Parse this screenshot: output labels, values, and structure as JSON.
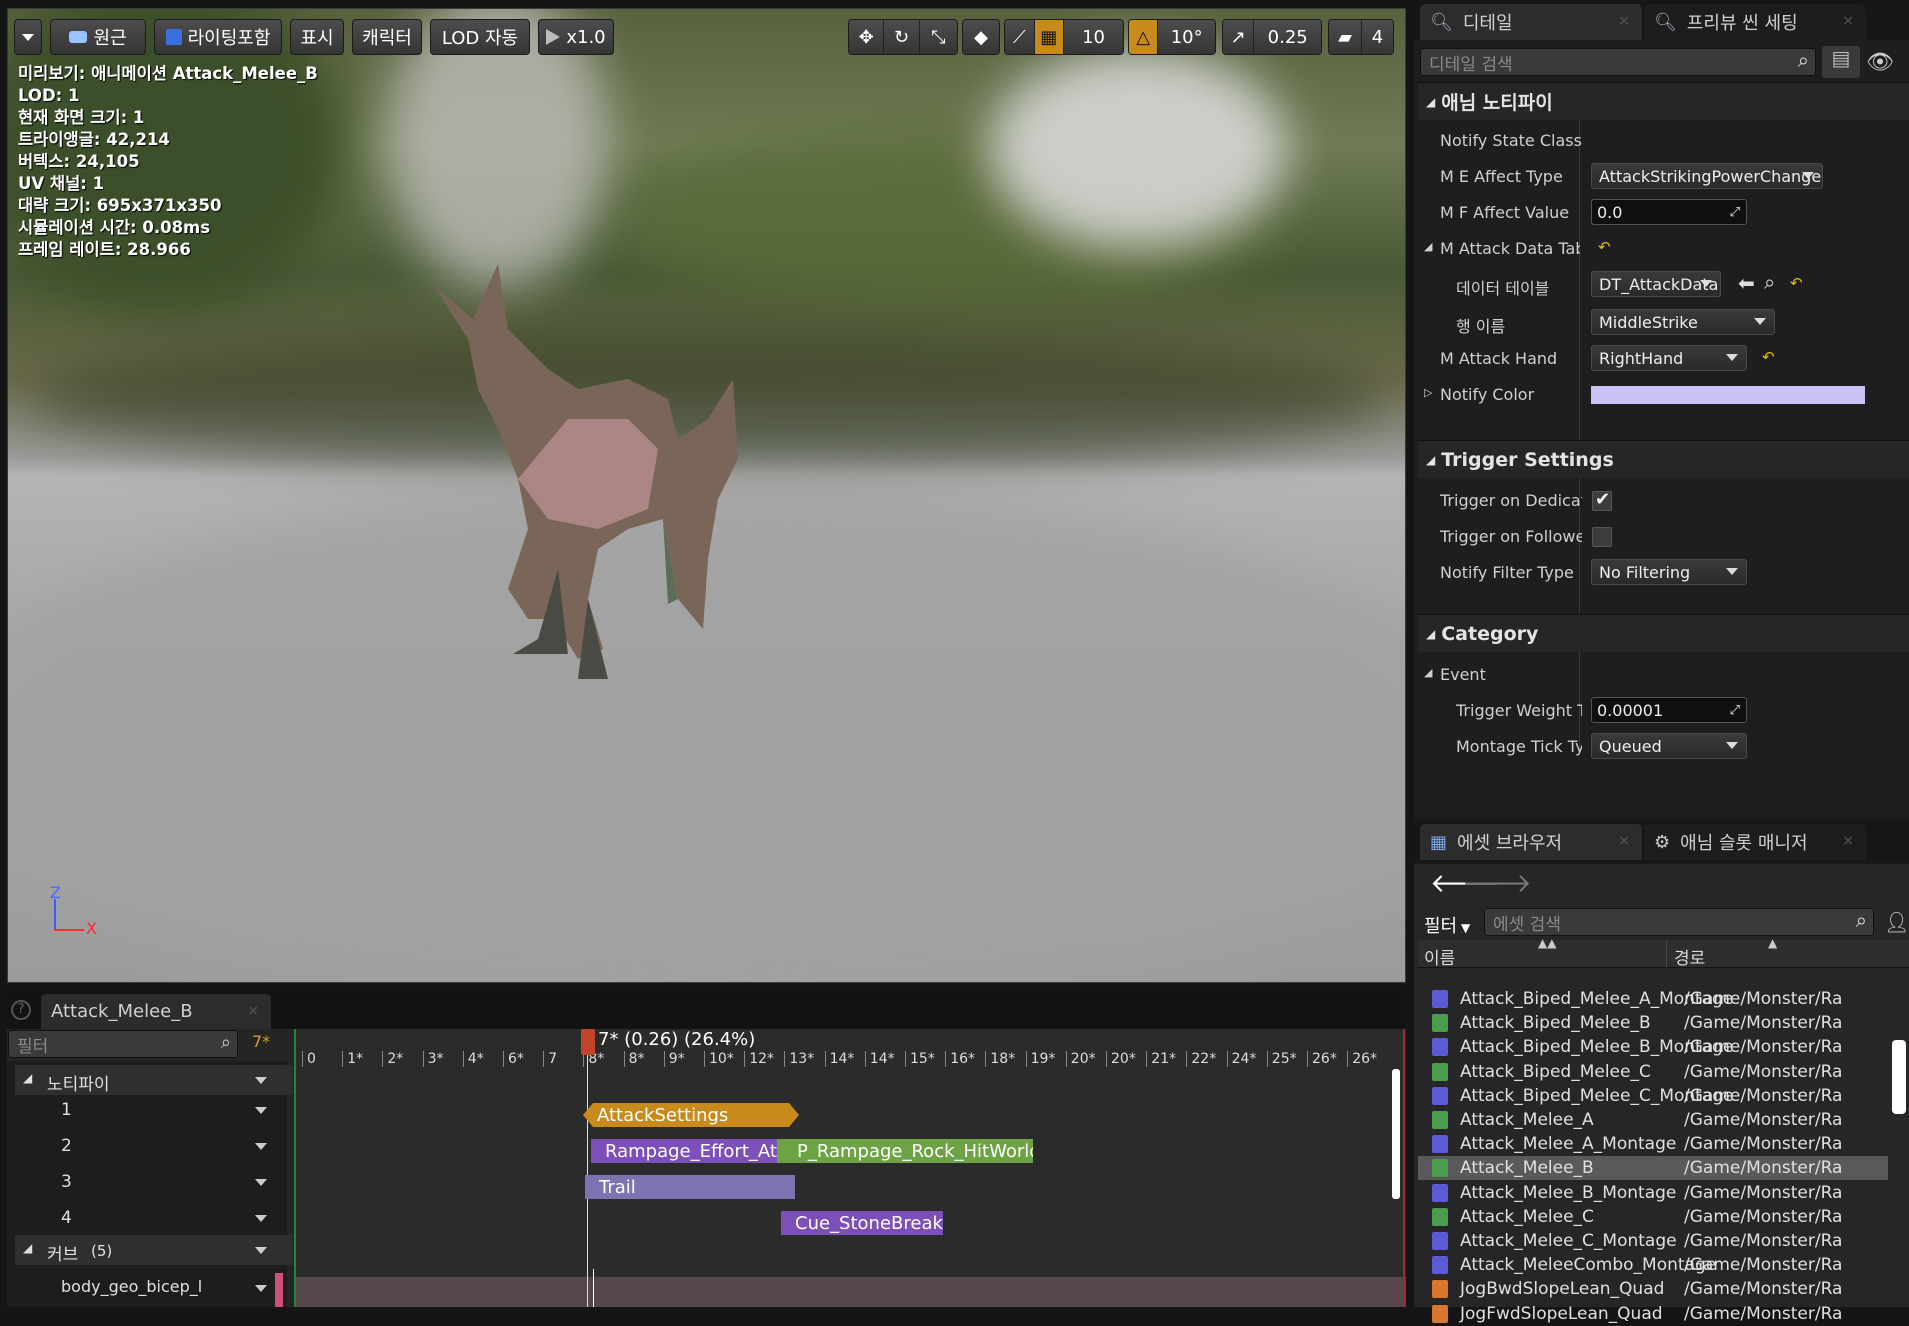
{
  "toolbar": {
    "perspective": "원근",
    "lighting": "라이팅포함",
    "show": "표시",
    "character": "캐릭터",
    "lod": "LOD 자동",
    "speed": "x1.0",
    "grid_snap": "10",
    "rot_snap": "10°",
    "scale_snap": "0.25",
    "cam_speed": "4"
  },
  "stats": [
    "미리보기: 애니메이션 Attack_Melee_B",
    "LOD: 1",
    "현재 화면 크기: 1",
    "트라이앵글: 42,214",
    "버텍스: 24,105",
    "UV 채널: 1",
    "대략 크기: 695x371x350",
    "시뮬레이션 시간: 0.08ms",
    "프레임 레이트: 28.966"
  ],
  "axes": {
    "z": "Z",
    "x": "X"
  },
  "details": {
    "tab1": "디테일",
    "tab2": "프리뷰 씬 세팅",
    "search_placeholder": "디테일 검색",
    "cat_notify": "애님 노티파이",
    "notify_state_class": "Notify State Class",
    "me_affect_type": "M E Affect Type",
    "me_affect_type_value": "AttackStrikingPowerChange",
    "mf_affect_value": "M F Affect Value",
    "mf_affect_value_value": "0.0",
    "m_attack_data_table": "M Attack Data Table",
    "data_table": "데이터 테이블",
    "data_table_value": "DT_AttackData",
    "row_name": "행 이름",
    "row_name_value": "MiddleStrike",
    "m_attack_hand": "M Attack Hand",
    "m_attack_hand_value": "RightHand",
    "notify_color": "Notify Color",
    "notify_color_value": "#c9c3f5",
    "cat_trigger": "Trigger Settings",
    "trigger_dedicated": "Trigger on Dedicated Server",
    "trigger_dedicated_checked": true,
    "trigger_follower": "Trigger on Follower",
    "trigger_follower_checked": false,
    "notify_filter_type": "Notify Filter Type",
    "notify_filter_type_value": "No Filtering",
    "cat_category": "Category",
    "event": "Event",
    "trigger_weight": "Trigger Weight Threshold",
    "trigger_weight_value": "0.00001",
    "montage_tick": "Montage Tick Type",
    "montage_tick_value": "Queued"
  },
  "assets": {
    "tab1": "에셋 브라우저",
    "tab2": "애님 슬롯 매니저",
    "filter": "필터",
    "search_placeholder": "에셋 검색",
    "col_name": "이름",
    "col_path": "경로",
    "rows": [
      {
        "name": "Attack_Biped_Melee_A_Montage",
        "path": "/Game/Monster/Ra",
        "kind": "montage"
      },
      {
        "name": "Attack_Biped_Melee_B",
        "path": "/Game/Monster/Ra",
        "kind": "anim"
      },
      {
        "name": "Attack_Biped_Melee_B_Montage",
        "path": "/Game/Monster/Ra",
        "kind": "montage"
      },
      {
        "name": "Attack_Biped_Melee_C",
        "path": "/Game/Monster/Ra",
        "kind": "anim"
      },
      {
        "name": "Attack_Biped_Melee_C_Montage",
        "path": "/Game/Monster/Ra",
        "kind": "montage"
      },
      {
        "name": "Attack_Melee_A",
        "path": "/Game/Monster/Ra",
        "kind": "anim"
      },
      {
        "name": "Attack_Melee_A_Montage",
        "path": "/Game/Monster/Ra",
        "kind": "montage"
      },
      {
        "name": "Attack_Melee_B",
        "path": "/Game/Monster/Ra",
        "kind": "anim",
        "selected": true
      },
      {
        "name": "Attack_Melee_B_Montage",
        "path": "/Game/Monster/Ra",
        "kind": "montage"
      },
      {
        "name": "Attack_Melee_C",
        "path": "/Game/Monster/Ra",
        "kind": "anim"
      },
      {
        "name": "Attack_Melee_C_Montage",
        "path": "/Game/Monster/Ra",
        "kind": "montage"
      },
      {
        "name": "Attack_MeleeCombo_Montage",
        "path": "/Game/Monster/Ra",
        "kind": "montage"
      },
      {
        "name": "JogBwdSlopeLean_Quad",
        "path": "/Game/Monster/Ra",
        "kind": "blend"
      },
      {
        "name": "JogFwdSlopeLean_Quad",
        "path": "/Game/Monster/Ra",
        "kind": "blend"
      }
    ]
  },
  "timeline": {
    "tab": "Attack_Melee_B",
    "filter_placeholder": "필터",
    "frame": "7*",
    "playhead": "7* (0.26) (26.4%)",
    "ticks": [
      "0",
      "1*",
      "2*",
      "3*",
      "4*",
      "6*",
      "7",
      "8*",
      "8*",
      "9*",
      "10*",
      "12*",
      "13*",
      "14*",
      "14*",
      "15*",
      "16*",
      "18*",
      "19*",
      "20*",
      "20*",
      "21*",
      "22*",
      "24*",
      "25*",
      "26*",
      "26*"
    ],
    "notifies_label": "노티파이",
    "tracks": [
      "1",
      "2",
      "3",
      "4"
    ],
    "curves_label": "커브",
    "curves_count": "(5)",
    "curve_item": "body_geo_bicep_l",
    "notify_items": [
      {
        "label": "AttackSettings",
        "color": "#c98a1c"
      },
      {
        "label": "Rampage_Effort_Attack",
        "color": "#7d4fb8"
      },
      {
        "label": "P_Rampage_Rock_HitWorld",
        "color": "#6ea345"
      },
      {
        "label": "Trail",
        "color": "#7c74b0"
      },
      {
        "label": "Cue_StoneBreak",
        "color": "#7d4fb8"
      }
    ]
  },
  "colors": {
    "accent": "#c98a1c",
    "montage": "#5b5bd6",
    "anim": "#4e9a4e",
    "blend": "#d9772e"
  }
}
